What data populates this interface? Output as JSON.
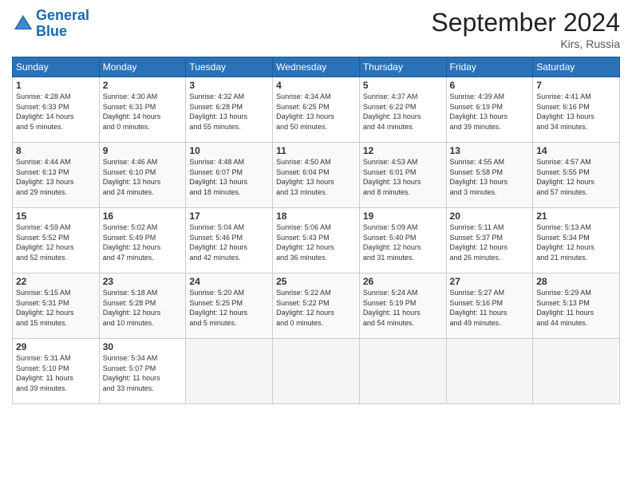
{
  "logo": {
    "line1": "General",
    "line2": "Blue"
  },
  "title": "September 2024",
  "location": "Kirs, Russia",
  "days_header": [
    "Sunday",
    "Monday",
    "Tuesday",
    "Wednesday",
    "Thursday",
    "Friday",
    "Saturday"
  ],
  "weeks": [
    [
      {
        "num": "1",
        "info": "Sunrise: 4:28 AM\nSunset: 6:33 PM\nDaylight: 14 hours\nand 5 minutes."
      },
      {
        "num": "2",
        "info": "Sunrise: 4:30 AM\nSunset: 6:31 PM\nDaylight: 14 hours\nand 0 minutes."
      },
      {
        "num": "3",
        "info": "Sunrise: 4:32 AM\nSunset: 6:28 PM\nDaylight: 13 hours\nand 55 minutes."
      },
      {
        "num": "4",
        "info": "Sunrise: 4:34 AM\nSunset: 6:25 PM\nDaylight: 13 hours\nand 50 minutes."
      },
      {
        "num": "5",
        "info": "Sunrise: 4:37 AM\nSunset: 6:22 PM\nDaylight: 13 hours\nand 44 minutes."
      },
      {
        "num": "6",
        "info": "Sunrise: 4:39 AM\nSunset: 6:19 PM\nDaylight: 13 hours\nand 39 minutes."
      },
      {
        "num": "7",
        "info": "Sunrise: 4:41 AM\nSunset: 6:16 PM\nDaylight: 13 hours\nand 34 minutes."
      }
    ],
    [
      {
        "num": "8",
        "info": "Sunrise: 4:44 AM\nSunset: 6:13 PM\nDaylight: 13 hours\nand 29 minutes."
      },
      {
        "num": "9",
        "info": "Sunrise: 4:46 AM\nSunset: 6:10 PM\nDaylight: 13 hours\nand 24 minutes."
      },
      {
        "num": "10",
        "info": "Sunrise: 4:48 AM\nSunset: 6:07 PM\nDaylight: 13 hours\nand 18 minutes."
      },
      {
        "num": "11",
        "info": "Sunrise: 4:50 AM\nSunset: 6:04 PM\nDaylight: 13 hours\nand 13 minutes."
      },
      {
        "num": "12",
        "info": "Sunrise: 4:53 AM\nSunset: 6:01 PM\nDaylight: 13 hours\nand 8 minutes."
      },
      {
        "num": "13",
        "info": "Sunrise: 4:55 AM\nSunset: 5:58 PM\nDaylight: 13 hours\nand 3 minutes."
      },
      {
        "num": "14",
        "info": "Sunrise: 4:57 AM\nSunset: 5:55 PM\nDaylight: 12 hours\nand 57 minutes."
      }
    ],
    [
      {
        "num": "15",
        "info": "Sunrise: 4:59 AM\nSunset: 5:52 PM\nDaylight: 12 hours\nand 52 minutes."
      },
      {
        "num": "16",
        "info": "Sunrise: 5:02 AM\nSunset: 5:49 PM\nDaylight: 12 hours\nand 47 minutes."
      },
      {
        "num": "17",
        "info": "Sunrise: 5:04 AM\nSunset: 5:46 PM\nDaylight: 12 hours\nand 42 minutes."
      },
      {
        "num": "18",
        "info": "Sunrise: 5:06 AM\nSunset: 5:43 PM\nDaylight: 12 hours\nand 36 minutes."
      },
      {
        "num": "19",
        "info": "Sunrise: 5:09 AM\nSunset: 5:40 PM\nDaylight: 12 hours\nand 31 minutes."
      },
      {
        "num": "20",
        "info": "Sunrise: 5:11 AM\nSunset: 5:37 PM\nDaylight: 12 hours\nand 26 minutes."
      },
      {
        "num": "21",
        "info": "Sunrise: 5:13 AM\nSunset: 5:34 PM\nDaylight: 12 hours\nand 21 minutes."
      }
    ],
    [
      {
        "num": "22",
        "info": "Sunrise: 5:15 AM\nSunset: 5:31 PM\nDaylight: 12 hours\nand 15 minutes."
      },
      {
        "num": "23",
        "info": "Sunrise: 5:18 AM\nSunset: 5:28 PM\nDaylight: 12 hours\nand 10 minutes."
      },
      {
        "num": "24",
        "info": "Sunrise: 5:20 AM\nSunset: 5:25 PM\nDaylight: 12 hours\nand 5 minutes."
      },
      {
        "num": "25",
        "info": "Sunrise: 5:22 AM\nSunset: 5:22 PM\nDaylight: 12 hours\nand 0 minutes."
      },
      {
        "num": "26",
        "info": "Sunrise: 5:24 AM\nSunset: 5:19 PM\nDaylight: 11 hours\nand 54 minutes."
      },
      {
        "num": "27",
        "info": "Sunrise: 5:27 AM\nSunset: 5:16 PM\nDaylight: 11 hours\nand 49 minutes."
      },
      {
        "num": "28",
        "info": "Sunrise: 5:29 AM\nSunset: 5:13 PM\nDaylight: 11 hours\nand 44 minutes."
      }
    ],
    [
      {
        "num": "29",
        "info": "Sunrise: 5:31 AM\nSunset: 5:10 PM\nDaylight: 11 hours\nand 39 minutes."
      },
      {
        "num": "30",
        "info": "Sunrise: 5:34 AM\nSunset: 5:07 PM\nDaylight: 11 hours\nand 33 minutes."
      },
      {
        "num": "",
        "info": ""
      },
      {
        "num": "",
        "info": ""
      },
      {
        "num": "",
        "info": ""
      },
      {
        "num": "",
        "info": ""
      },
      {
        "num": "",
        "info": ""
      }
    ]
  ]
}
